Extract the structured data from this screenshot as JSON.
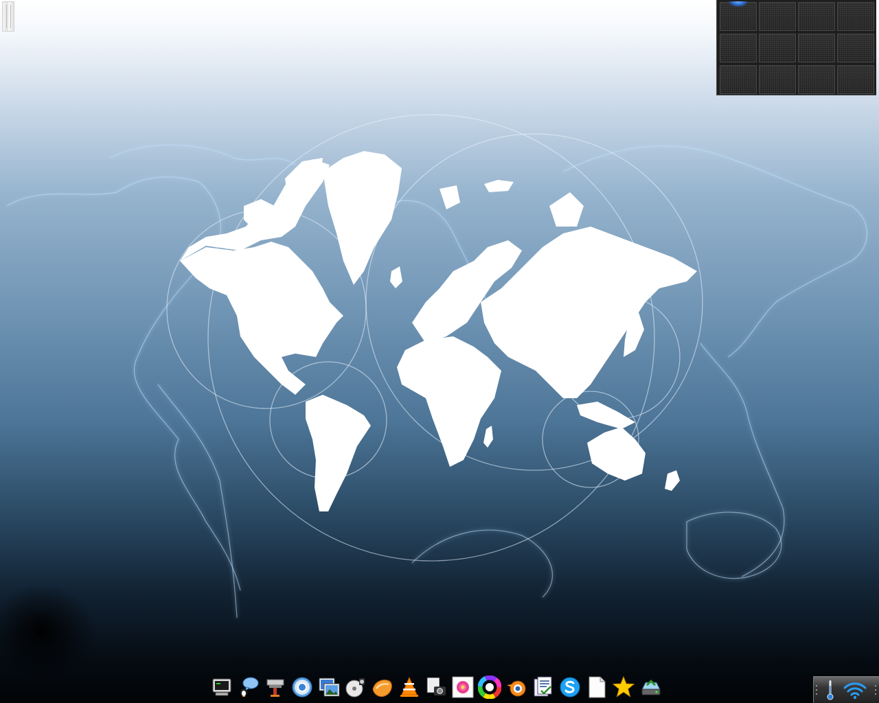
{
  "desktop": {
    "wallpaper": "world-map-wallpaper",
    "background_colors": [
      "#ffffff",
      "#6e93b3",
      "#2d4e69",
      "#020406"
    ]
  },
  "pager": {
    "rows": 3,
    "columns": 4,
    "active_desktop": 1,
    "desktops": [
      {
        "name": "desktop-1"
      },
      {
        "name": "desktop-2"
      },
      {
        "name": "desktop-3"
      },
      {
        "name": "desktop-4"
      },
      {
        "name": "desktop-5"
      },
      {
        "name": "desktop-6"
      },
      {
        "name": "desktop-7"
      },
      {
        "name": "desktop-8"
      },
      {
        "name": "desktop-9"
      },
      {
        "name": "desktop-10"
      },
      {
        "name": "desktop-11"
      },
      {
        "name": "desktop-12"
      }
    ]
  },
  "dock": {
    "items": [
      {
        "icon": "terminal-icon"
      },
      {
        "icon": "pidgin-chat-icon"
      },
      {
        "icon": "package-manager-icon"
      },
      {
        "icon": "chromium-browser-icon"
      },
      {
        "icon": "image-viewer-icon"
      },
      {
        "icon": "media-player-icon"
      },
      {
        "icon": "browser-orange-icon"
      },
      {
        "icon": "vlc-player-icon"
      },
      {
        "icon": "screenshot-camera-icon"
      },
      {
        "icon": "flower-photo-icon"
      },
      {
        "icon": "color-wheel-icon"
      },
      {
        "icon": "blender-icon"
      },
      {
        "icon": "document-viewer-icon"
      },
      {
        "icon": "skype-icon"
      },
      {
        "icon": "text-document-icon"
      },
      {
        "icon": "favorites-star-icon"
      },
      {
        "icon": "network-drive-icon"
      }
    ]
  },
  "tray": {
    "items": [
      {
        "icon": "thermometer-icon"
      },
      {
        "icon": "wifi-icon",
        "color": "#2a9df4"
      }
    ]
  }
}
